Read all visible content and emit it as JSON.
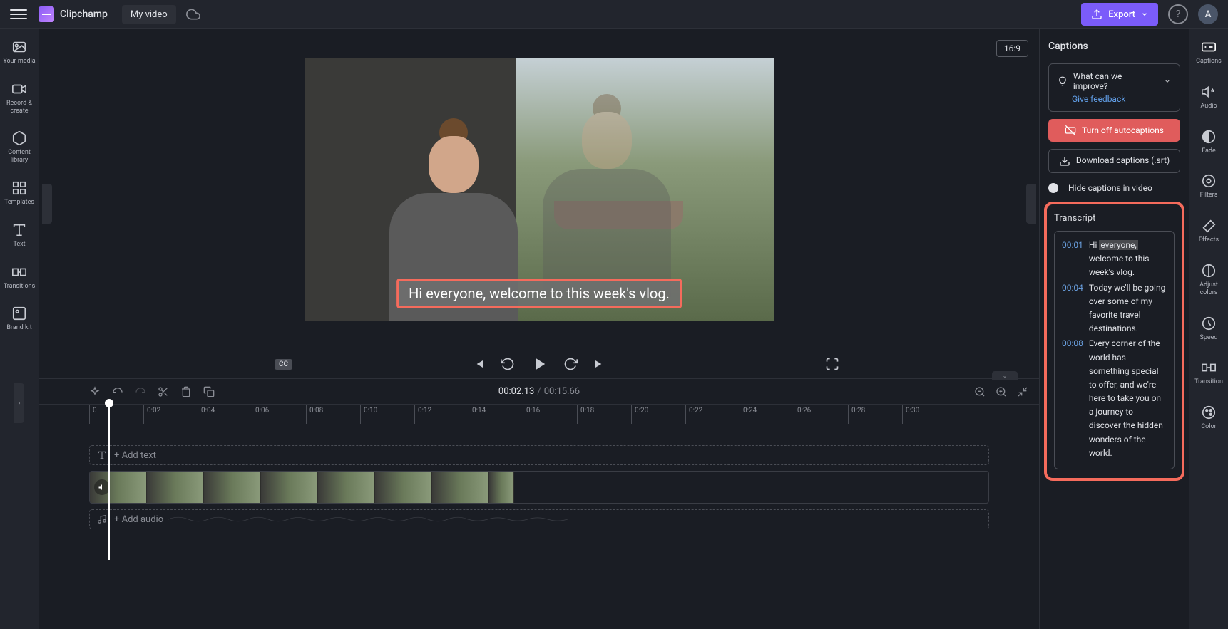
{
  "app": {
    "name": "Clipchamp",
    "video_title": "My video",
    "export_label": "Export",
    "avatar_letter": "A"
  },
  "left_rail": {
    "items": [
      {
        "label": "Your media"
      },
      {
        "label": "Record & create"
      },
      {
        "label": "Content library"
      },
      {
        "label": "Templates"
      },
      {
        "label": "Text"
      },
      {
        "label": "Transitions"
      },
      {
        "label": "Brand kit"
      }
    ]
  },
  "preview": {
    "aspect": "16:9",
    "cc_badge": "CC",
    "caption_text": "Hi everyone, welcome to this week's vlog."
  },
  "player": {
    "current_time": "00:02.13",
    "total_time": "00:15.66"
  },
  "ruler": [
    "0",
    "0:02",
    "0:04",
    "0:06",
    "0:08",
    "0:10",
    "0:12",
    "0:14",
    "0:16",
    "0:18",
    "0:20",
    "0:22",
    "0:24",
    "0:26",
    "0:28",
    "0:30"
  ],
  "tracks": {
    "text_placeholder": "+ Add text",
    "audio_placeholder": "+ Add audio"
  },
  "captions_panel": {
    "title": "Captions",
    "feedback_question": "What can we improve?",
    "feedback_link": "Give feedback",
    "turn_off": "Turn off autocaptions",
    "download": "Download captions (.srt)",
    "hide_toggle": "Hide captions in video",
    "transcript_title": "Transcript",
    "transcript": [
      {
        "ts": "00:01",
        "prefix": "Hi ",
        "highlight": "everyone,",
        "text": " welcome to this week's vlog."
      },
      {
        "ts": "00:04",
        "text": "Today we'll be going over some of my favorite travel destinations."
      },
      {
        "ts": "00:08",
        "text": "Every corner of the world has something special to offer, and we're here to take you on a journey to discover the hidden wonders of the world."
      }
    ]
  },
  "right_rail": {
    "items": [
      {
        "label": "Captions"
      },
      {
        "label": "Audio"
      },
      {
        "label": "Fade"
      },
      {
        "label": "Filters"
      },
      {
        "label": "Effects"
      },
      {
        "label": "Adjust colors"
      },
      {
        "label": "Speed"
      },
      {
        "label": "Transition"
      },
      {
        "label": "Color"
      }
    ]
  }
}
